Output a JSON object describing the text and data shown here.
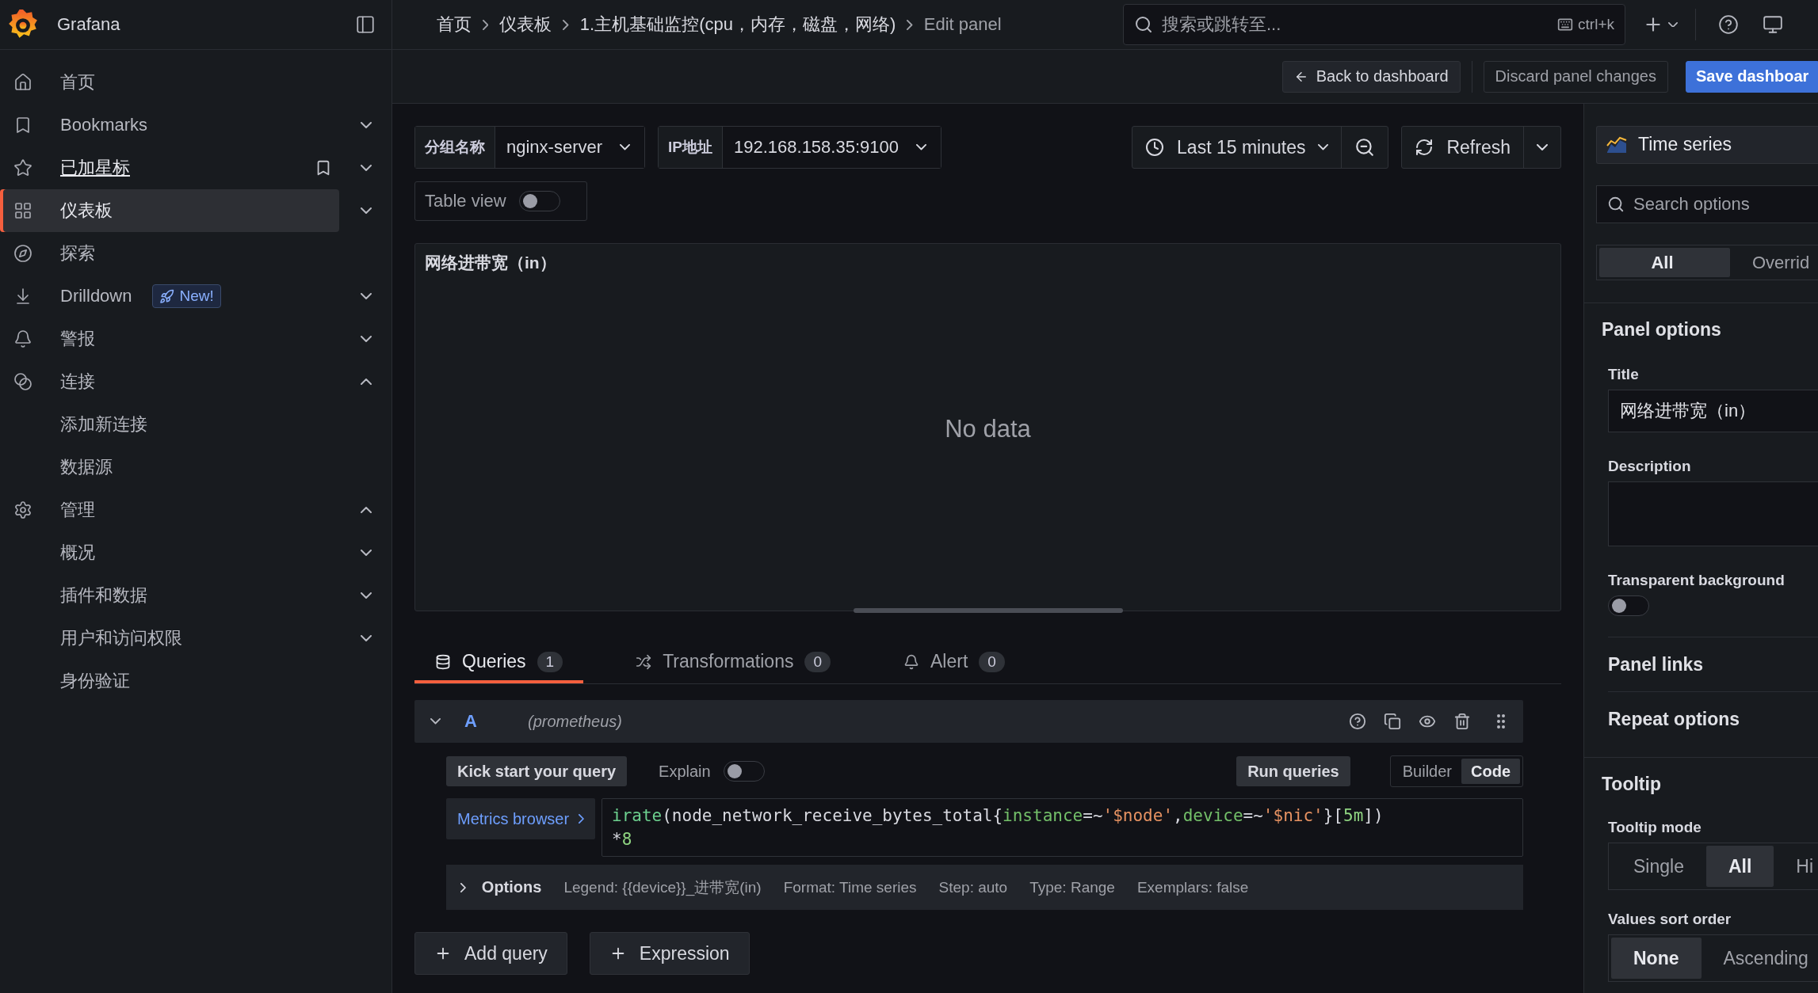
{
  "brand": {
    "name": "Grafana"
  },
  "breadcrumbs": [
    {
      "label": "首页"
    },
    {
      "label": "仪表板"
    },
    {
      "label": "1.主机基础监控(cpu，内存，磁盘，网络)"
    },
    {
      "label": "Edit panel"
    }
  ],
  "search": {
    "placeholder": "搜索或跳转至...",
    "shortcut": "ctrl+k"
  },
  "sidebar": {
    "items": [
      {
        "label": "首页",
        "selected": false,
        "hovered": false
      },
      {
        "label": "Bookmarks",
        "selected": false,
        "hovered": false,
        "expanded": false
      },
      {
        "label": "已加星标",
        "selected": false,
        "hovered": true,
        "expanded": false
      },
      {
        "label": "仪表板",
        "selected": true,
        "hovered": false,
        "expanded": false
      },
      {
        "label": "探索",
        "selected": false,
        "hovered": false
      },
      {
        "label": "Drilldown",
        "selected": false,
        "hovered": false,
        "expanded": false,
        "badge": "New!"
      },
      {
        "label": "警报",
        "selected": false,
        "hovered": false,
        "expanded": false
      },
      {
        "label": "连接",
        "selected": false,
        "hovered": false,
        "expanded": true,
        "children": [
          {
            "label": "添加新连接",
            "selected": false,
            "hovered": false
          },
          {
            "label": "数据源",
            "selected": false,
            "hovered": false
          }
        ]
      },
      {
        "label": "管理",
        "selected": false,
        "hovered": false,
        "expanded": true,
        "children": [
          {
            "label": "概况",
            "selected": false,
            "hovered": false,
            "expanded": false
          },
          {
            "label": "插件和数据",
            "selected": false,
            "hovered": false,
            "expanded": false
          },
          {
            "label": "用户和访问权限",
            "selected": false,
            "hovered": false,
            "expanded": false
          },
          {
            "label": "身份验证",
            "selected": false,
            "hovered": false
          }
        ]
      }
    ]
  },
  "toolbar": {
    "back": "Back to dashboard",
    "discard": "Discard panel changes",
    "save": "Save dashboar"
  },
  "variables": [
    {
      "label": "分组名称",
      "value": "nginx-server"
    },
    {
      "label": "IP地址",
      "value": "192.168.158.35:9100"
    }
  ],
  "time_range": "Last 15 minutes",
  "refresh": "Refresh",
  "table_view": {
    "label": "Table view",
    "on": false
  },
  "panel": {
    "title": "网络进带宽（in）",
    "message": "No data"
  },
  "query_tabs": [
    {
      "label": "Queries",
      "count": "1",
      "selected": true
    },
    {
      "label": "Transformations",
      "count": "0",
      "selected": false
    },
    {
      "label": "Alert",
      "count": "0",
      "selected": false
    }
  ],
  "query": {
    "ref": "A",
    "datasource": "(prometheus)",
    "expanded": true,
    "kick_start": "Kick start your query",
    "explain": {
      "label": "Explain",
      "on": false
    },
    "run": "Run queries",
    "modes": [
      {
        "label": "Builder",
        "selected": false
      },
      {
        "label": "Code",
        "selected": true
      }
    ],
    "metrics_browser": "Metrics browser",
    "code_lines": [
      [
        {
          "kind": "fn",
          "text": "irate"
        },
        {
          "kind": "plain",
          "text": "(node_network_receive_bytes_total{"
        },
        {
          "kind": "key",
          "text": "instance"
        },
        {
          "kind": "plain",
          "text": "=~"
        },
        {
          "kind": "str",
          "text": "'$node'"
        },
        {
          "kind": "plain",
          "text": ","
        },
        {
          "kind": "key",
          "text": "device"
        },
        {
          "kind": "plain",
          "text": "=~"
        },
        {
          "kind": "str",
          "text": "'$nic'"
        },
        {
          "kind": "plain",
          "text": "}["
        },
        {
          "kind": "num",
          "text": "5m"
        },
        {
          "kind": "plain",
          "text": "])"
        }
      ],
      [
        {
          "kind": "plain",
          "text": "*"
        },
        {
          "kind": "num",
          "text": "8"
        }
      ]
    ],
    "options": {
      "label": "Options",
      "expanded": false,
      "items": [
        "Legend: {{device}}_进带宽(in)",
        "Format: Time series",
        "Step: auto",
        "Type: Range",
        "Exemplars: false"
      ]
    }
  },
  "add_buttons": [
    "Add query",
    "Expression"
  ],
  "options_pane": {
    "visualization": "Time series",
    "search_placeholder": "Search options",
    "tabs": [
      {
        "label": "All",
        "selected": true
      },
      {
        "label": "Overrid",
        "selected": false
      }
    ],
    "panel_options": {
      "heading": "Panel options",
      "title_label": "Title",
      "title_value": "网络进带宽（in）",
      "description_label": "Description",
      "transparent": {
        "label": "Transparent background",
        "on": false
      }
    },
    "collapsed_sections": [
      "Panel links",
      "Repeat options"
    ],
    "tooltip": {
      "heading": "Tooltip",
      "mode_label": "Tooltip mode",
      "modes": [
        {
          "label": "Single",
          "selected": false
        },
        {
          "label": "All",
          "selected": true
        },
        {
          "label": "Hi",
          "selected": false
        }
      ],
      "sort_label": "Values sort order",
      "sorts": [
        {
          "label": "None",
          "selected": true
        },
        {
          "label": "Ascending",
          "selected": false
        }
      ]
    }
  }
}
